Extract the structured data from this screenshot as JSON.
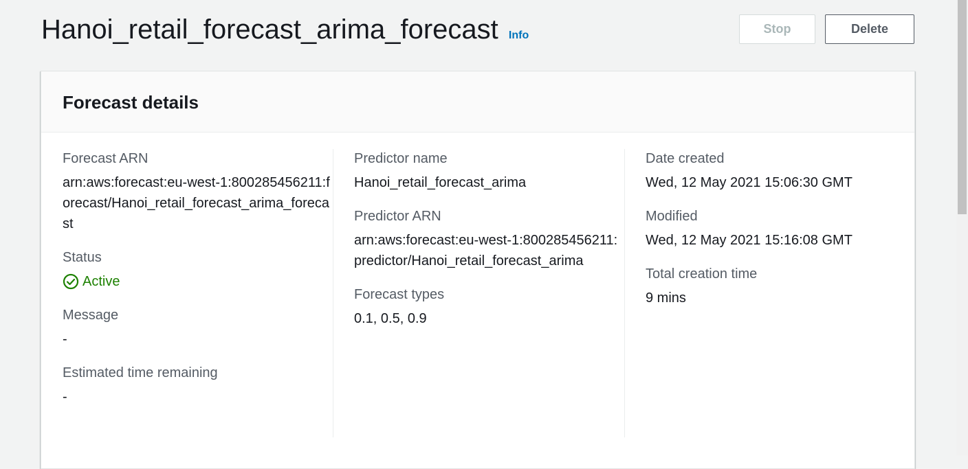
{
  "header": {
    "title": "Hanoi_retail_forecast_arima_forecast",
    "info_label": "Info",
    "stop_label": "Stop",
    "delete_label": "Delete"
  },
  "panel": {
    "title": "Forecast details"
  },
  "details": {
    "forecast_arn_label": "Forecast ARN",
    "forecast_arn_value": "arn:aws:forecast:eu-west-1:800285456211:forecast/Hanoi_retail_forecast_arima_forecast",
    "status_label": "Status",
    "status_value": "Active",
    "message_label": "Message",
    "message_value": "-",
    "eta_label": "Estimated time remaining",
    "eta_value": "-",
    "predictor_name_label": "Predictor name",
    "predictor_name_value": "Hanoi_retail_forecast_arima",
    "predictor_arn_label": "Predictor ARN",
    "predictor_arn_value": "arn:aws:forecast:eu-west-1:800285456211:predictor/Hanoi_retail_forecast_arima",
    "forecast_types_label": "Forecast types",
    "forecast_types_value": "0.1, 0.5, 0.9",
    "date_created_label": "Date created",
    "date_created_value": "Wed, 12 May 2021 15:06:30 GMT",
    "modified_label": "Modified",
    "modified_value": "Wed, 12 May 2021 15:16:08 GMT",
    "total_time_label": "Total creation time",
    "total_time_value": "9 mins"
  },
  "colors": {
    "status_active": "#1d8102",
    "link": "#0073bb"
  },
  "icons": {
    "status": "check-circle-icon"
  }
}
